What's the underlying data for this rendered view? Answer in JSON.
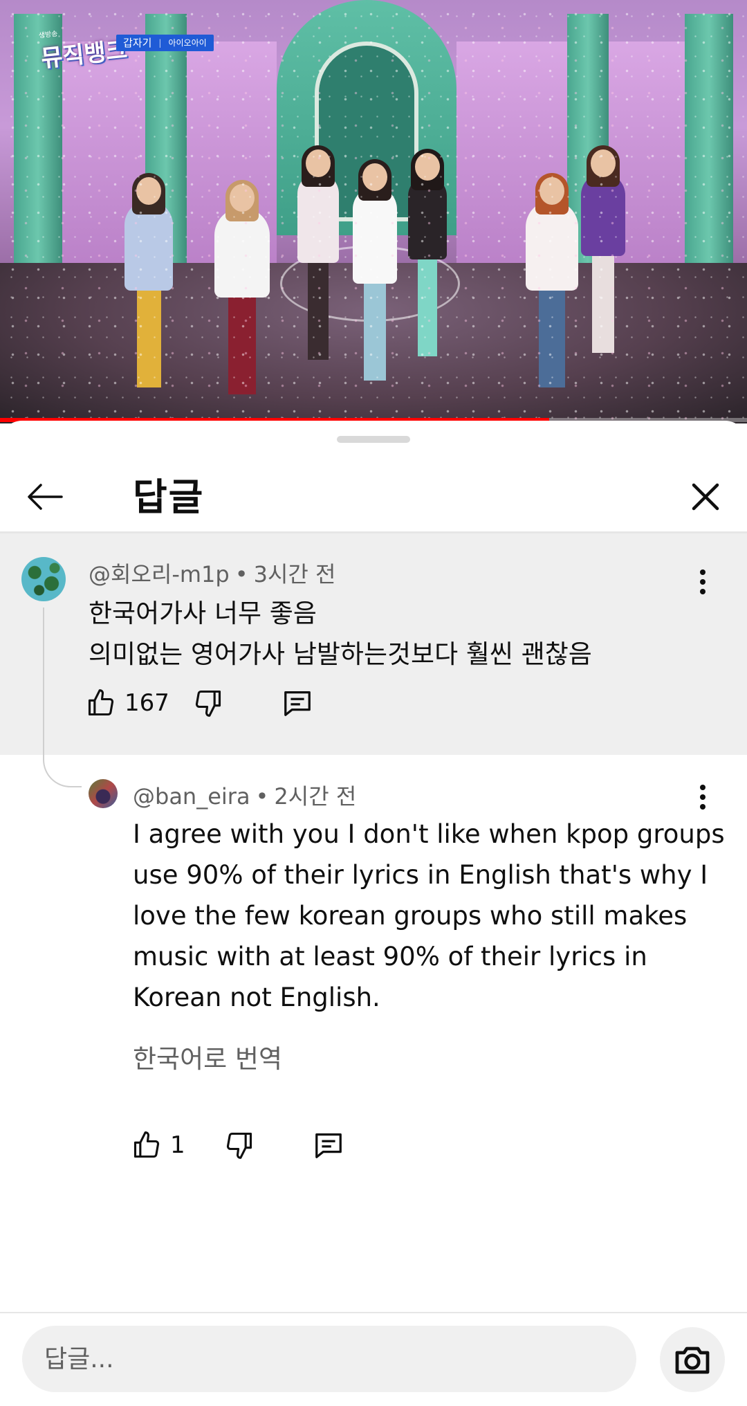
{
  "video": {
    "broadcast_logo_small": "생방송",
    "broadcast_logo": "뮤직뱅크",
    "song_title": "갑자기",
    "artist": "아이오아이",
    "progress": 0.735
  },
  "sheet": {
    "title": "답글"
  },
  "parent_comment": {
    "handle": "@회오리-m1p",
    "time": "3시간 전",
    "lines": [
      "한국어가사 너무 좋음",
      "의미없는 영어가사 남발하는것보다 훨씬 괜찮음"
    ],
    "like_count": "167"
  },
  "reply": {
    "handle": "@ban_eira",
    "time": "2시간 전",
    "lines": [
      "I agree with you I don't like when kpop groups",
      "use 90% of their lyrics in English that's why I",
      "love the few korean groups who still makes",
      "music with at least 90% of their lyrics in",
      "Korean not English."
    ],
    "translate_label": "한국어로 번역",
    "like_count": "1"
  },
  "composer": {
    "placeholder": "답글..."
  },
  "icons": {
    "back": "arrow-left-icon",
    "close": "close-icon",
    "more": "more-vertical-icon",
    "like": "thumbs-up-icon",
    "dislike": "thumbs-down-icon",
    "reply": "comment-icon",
    "camera": "camera-icon"
  },
  "colors": {
    "progress": "#ff0000",
    "parent_bg": "#efefef",
    "secondary_text": "#606060"
  }
}
